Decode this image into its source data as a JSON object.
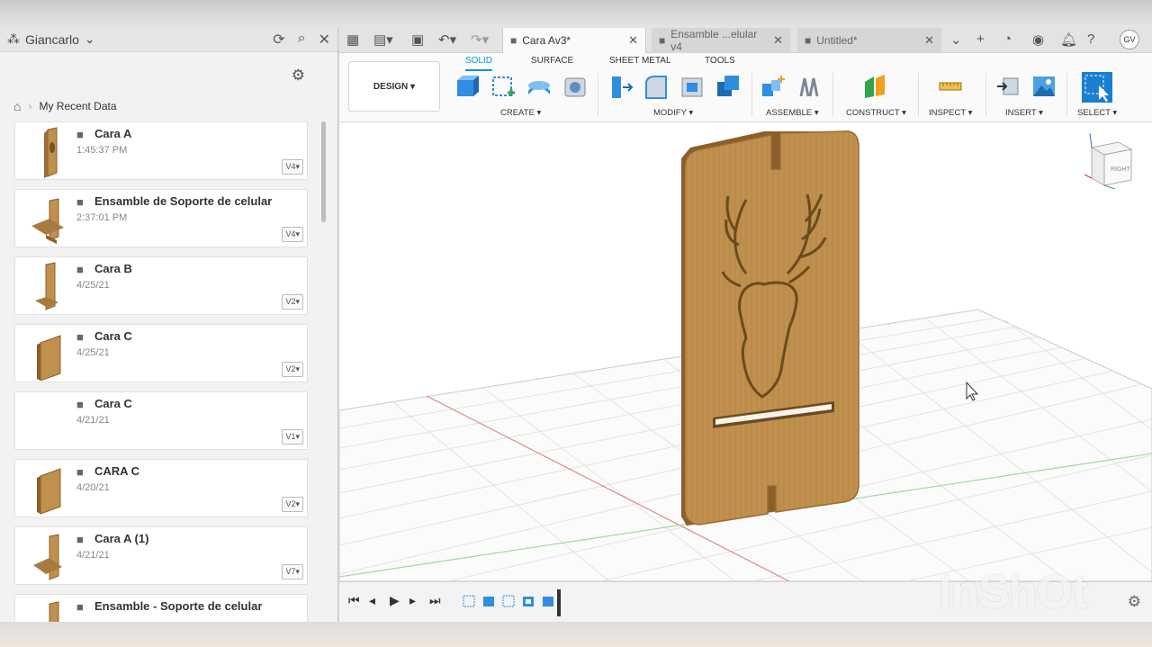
{
  "data_panel": {
    "user": "Giancarlo",
    "breadcrumb": "My Recent Data",
    "items": [
      {
        "name": "Cara A",
        "date": "1:45:37 PM",
        "version": "V4"
      },
      {
        "name": "Ensamble de Soporte de celular",
        "date": "2:37:01 PM",
        "version": "V4"
      },
      {
        "name": "Cara B",
        "date": "4/25/21",
        "version": "V2"
      },
      {
        "name": "Cara C",
        "date": "4/25/21",
        "version": "V2"
      },
      {
        "name": "Cara C",
        "date": "4/21/21",
        "version": "V1"
      },
      {
        "name": "CARA C",
        "date": "4/20/21",
        "version": "V2"
      },
      {
        "name": "Cara A (1)",
        "date": "4/21/21",
        "version": "V7"
      },
      {
        "name": "Ensamble - Soporte de celular",
        "date": "",
        "version": ""
      }
    ]
  },
  "tabs": [
    {
      "label": "Cara Av3*",
      "active": true
    },
    {
      "label": "Ensamble ...elular v4",
      "active": false
    },
    {
      "label": "Untitled*",
      "active": false
    }
  ],
  "avatar": "GV",
  "toolbar": {
    "workspace": "DESIGN",
    "workspace_tabs": [
      "SOLID",
      "SURFACE",
      "SHEET METAL",
      "TOOLS"
    ],
    "groups": [
      "CREATE",
      "MODIFY",
      "ASSEMBLE",
      "CONSTRUCT",
      "INSPECT",
      "INSERT",
      "SELECT"
    ]
  },
  "viewcube_label": "RIGHT",
  "watermark": "InShOt",
  "colors": {
    "accent": "#0696d7",
    "wood": "#c0904e",
    "wood_dark": "#8a5f2a"
  }
}
